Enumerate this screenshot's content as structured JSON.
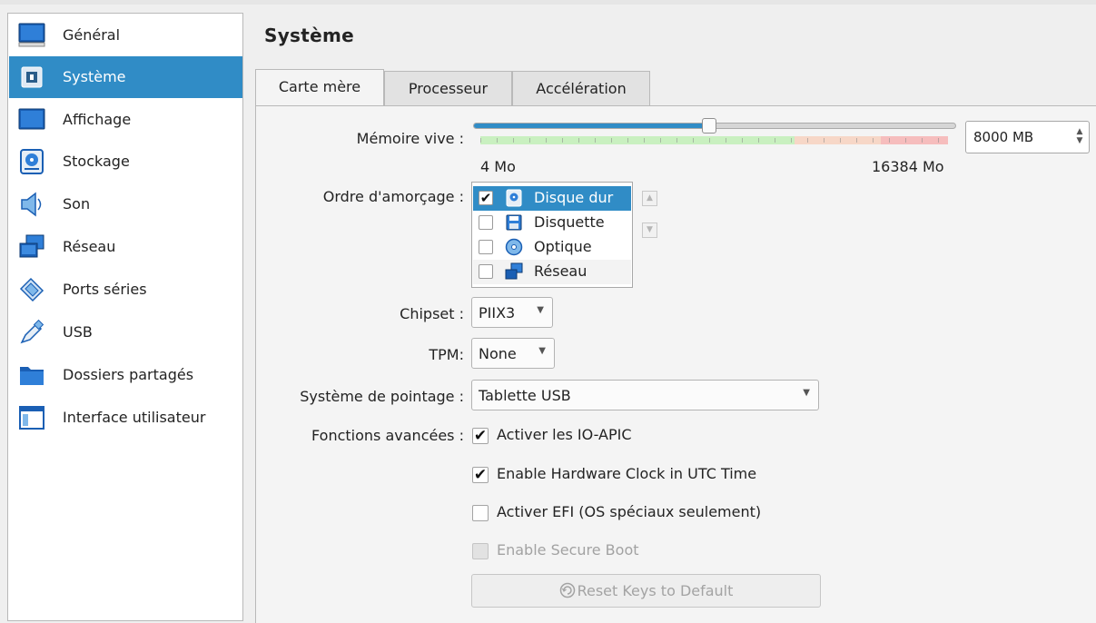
{
  "sidebar": {
    "items": [
      {
        "label": "Général",
        "icon": "monitor-icon"
      },
      {
        "label": "Système",
        "icon": "chip-icon"
      },
      {
        "label": "Affichage",
        "icon": "display-icon"
      },
      {
        "label": "Stockage",
        "icon": "hard-disk-icon"
      },
      {
        "label": "Son",
        "icon": "speaker-icon"
      },
      {
        "label": "Réseau",
        "icon": "network-icon"
      },
      {
        "label": "Ports séries",
        "icon": "serial-port-icon"
      },
      {
        "label": "USB",
        "icon": "usb-icon"
      },
      {
        "label": "Dossiers partagés",
        "icon": "folder-icon"
      },
      {
        "label": "Interface utilisateur",
        "icon": "window-icon"
      }
    ],
    "selected": "Système"
  },
  "page_title": "Système",
  "tabs": [
    {
      "label": "Carte mère",
      "active": true
    },
    {
      "label": "Processeur",
      "active": false
    },
    {
      "label": "Accélération",
      "active": false
    }
  ],
  "memory": {
    "label": "Mémoire vive :",
    "value": "8000 MB",
    "min_label": "4 Mo",
    "max_label": "16384 Mo",
    "min": 4,
    "max": 16384,
    "current": 8000
  },
  "boot_order": {
    "label": "Ordre d'amorçage :",
    "items": [
      {
        "label": "Disque dur",
        "checked": true,
        "icon": "hard-disk-icon"
      },
      {
        "label": "Disquette",
        "checked": false,
        "icon": "floppy-icon"
      },
      {
        "label": "Optique",
        "checked": false,
        "icon": "optical-disc-icon"
      },
      {
        "label": "Réseau",
        "checked": false,
        "icon": "network-icon"
      }
    ]
  },
  "chipset": {
    "label": "Chipset :",
    "value": "PIIX3"
  },
  "tpm": {
    "label": "TPM:",
    "value": "None"
  },
  "pointing": {
    "label": "Système de pointage :",
    "value": "Tablette USB"
  },
  "advanced": {
    "label": "Fonctions avancées :",
    "ioapic": {
      "label": "Activer les IO-APIC",
      "checked": true
    },
    "utc": {
      "label": "Enable Hardware Clock in UTC Time",
      "checked": true
    },
    "efi": {
      "label": "Activer EFI (OS spéciaux seulement)",
      "checked": false
    },
    "secure_boot": {
      "label": "Enable Secure Boot",
      "checked": false,
      "enabled": false
    }
  },
  "reset_button": {
    "label": "Reset Keys to Default",
    "enabled": false
  },
  "colors": {
    "accent": "#308cc6"
  }
}
